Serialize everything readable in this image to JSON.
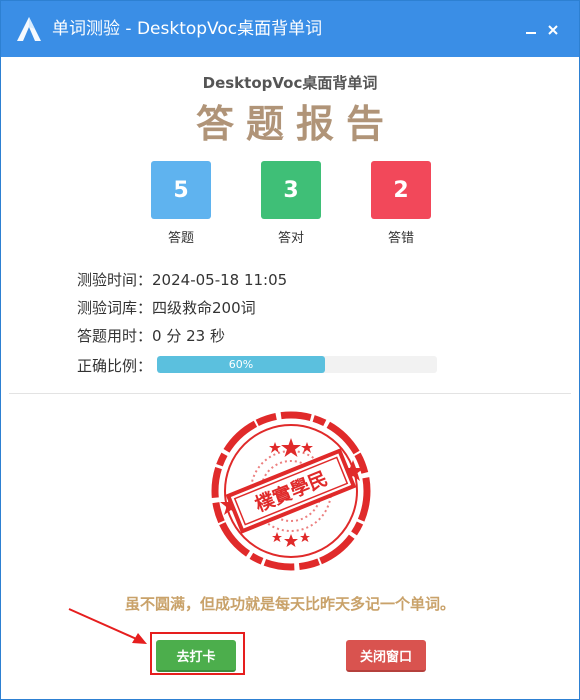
{
  "window": {
    "title": "单词测验 - DesktopVoc桌面背单词",
    "minimize_symbol": "−",
    "close_symbol": "✕"
  },
  "header": {
    "app_name": "DesktopVoc桌面背单词",
    "report_title": "答题报告"
  },
  "stats": [
    {
      "value": "5",
      "label": "答题",
      "color": "#5fb3ef"
    },
    {
      "value": "3",
      "label": "答对",
      "color": "#3fbf77"
    },
    {
      "value": "2",
      "label": "答错",
      "color": "#f2485a"
    }
  ],
  "info": {
    "time_label": "测验时间：",
    "time_value": "2024-05-18 11:05",
    "library_label": "测验词库：",
    "library_value": "四级救命200词",
    "duration_label": "答题用时：",
    "duration_value": "0 分 23 秒",
    "ratio_label": "正确比例：",
    "ratio_text": "60%",
    "ratio_value": 0.6
  },
  "stamp": {
    "text": "樸實學民",
    "color": "#e02a2a"
  },
  "motto": "虽不圆满，但成功就是每天比昨天多记一个单词。",
  "buttons": {
    "checkin": "去打卡",
    "close_window": "关闭窗口"
  },
  "colors": {
    "titlebar": "#3a8ee6",
    "accent_title": "#b09478",
    "motto": "#c9a26a",
    "progress": "#5bc0de",
    "annotation": "#e61e1e"
  }
}
